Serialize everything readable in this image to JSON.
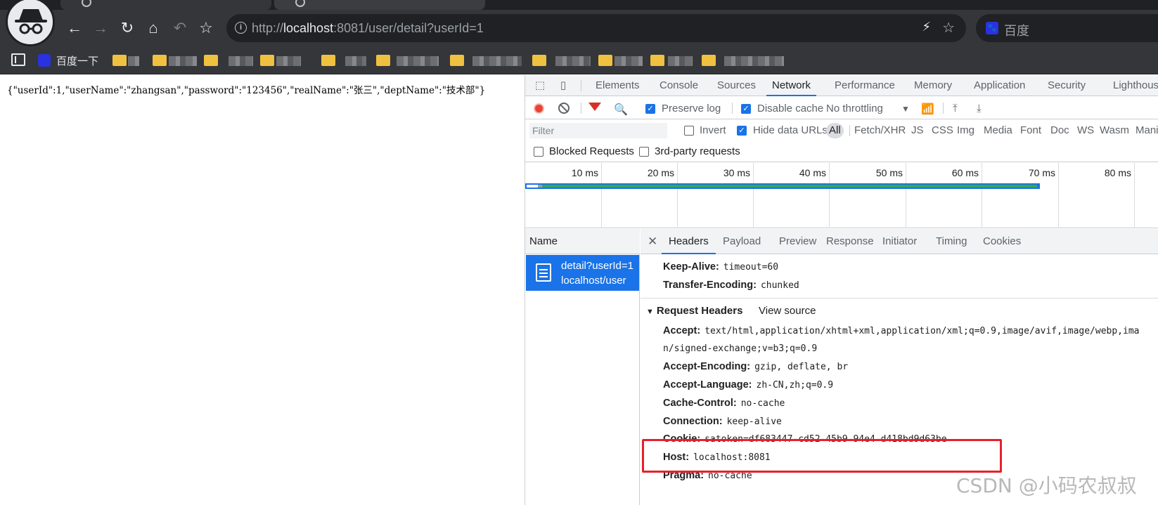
{
  "browser": {
    "url_prefix": "http://",
    "url_host": "localhost",
    "url_rest": ":8081/user/detail?userId=1",
    "search_engine_label": "百度",
    "bookmarks": {
      "first_label": "百度一下"
    }
  },
  "page": {
    "json_text": "{\"userId\":1,\"userName\":\"zhangsan\",\"password\":\"123456\",\"realName\":\"张三\",\"deptName\":\"技术部\"}"
  },
  "devtools": {
    "tabs": [
      "Elements",
      "Console",
      "Sources",
      "Network",
      "Performance",
      "Memory",
      "Application",
      "Security",
      "Lighthouse"
    ],
    "active_tab": "Network",
    "toolbar": {
      "preserve_log": "Preserve log",
      "disable_cache": "Disable cache",
      "throttling": "No throttling"
    },
    "filterbar": {
      "filter_placeholder": "Filter",
      "invert": "Invert",
      "hide_data_urls": "Hide data URLs",
      "types": [
        "All",
        "Fetch/XHR",
        "JS",
        "CSS",
        "Img",
        "Media",
        "Font",
        "Doc",
        "WS",
        "Wasm",
        "Manifest"
      ]
    },
    "blocked_requests": "Blocked Requests",
    "third_party": "3rd-party requests",
    "timeline_ticks": [
      "10 ms",
      "20 ms",
      "30 ms",
      "40 ms",
      "50 ms",
      "60 ms",
      "70 ms",
      "80 ms"
    ],
    "name_column": "Name",
    "request": {
      "name": "detail?userId=1",
      "path": "localhost/user"
    },
    "detail_tabs": [
      "Headers",
      "Payload",
      "Preview",
      "Response",
      "Initiator",
      "Timing",
      "Cookies"
    ],
    "response_headers_tail": [
      {
        "key": "Keep-Alive:",
        "value": "timeout=60"
      },
      {
        "key": "Transfer-Encoding:",
        "value": "chunked"
      }
    ],
    "request_headers_title": "Request Headers",
    "view_source": "View source",
    "request_headers": {
      "accept_key": "Accept:",
      "accept_value": "text/html,application/xhtml+xml,application/xml;q=0.9,image/avif,image/webp,ima",
      "accept_cont": "n/signed-exchange;v=b3;q=0.9",
      "accept_encoding_key": "Accept-Encoding:",
      "accept_encoding_value": "gzip, deflate, br",
      "accept_language_key": "Accept-Language:",
      "accept_language_value": "zh-CN,zh;q=0.9",
      "cache_control_key": "Cache-Control:",
      "cache_control_value": "no-cache",
      "connection_key": "Connection:",
      "connection_value": "keep-alive",
      "cookie_key": "Cookie:",
      "cookie_value": "satoken=df683447-cd52-45b9-94e4-d418bd9d63be",
      "host_key": "Host:",
      "host_value": "localhost:8081",
      "pragma_key": "Pragma:",
      "pragma_value": "no-cache"
    }
  },
  "watermark": "CSDN @小码农叔叔",
  "colors": {
    "accent": "#1a73e8",
    "highlight_box": "#e8202a",
    "record": "#ea4335"
  }
}
